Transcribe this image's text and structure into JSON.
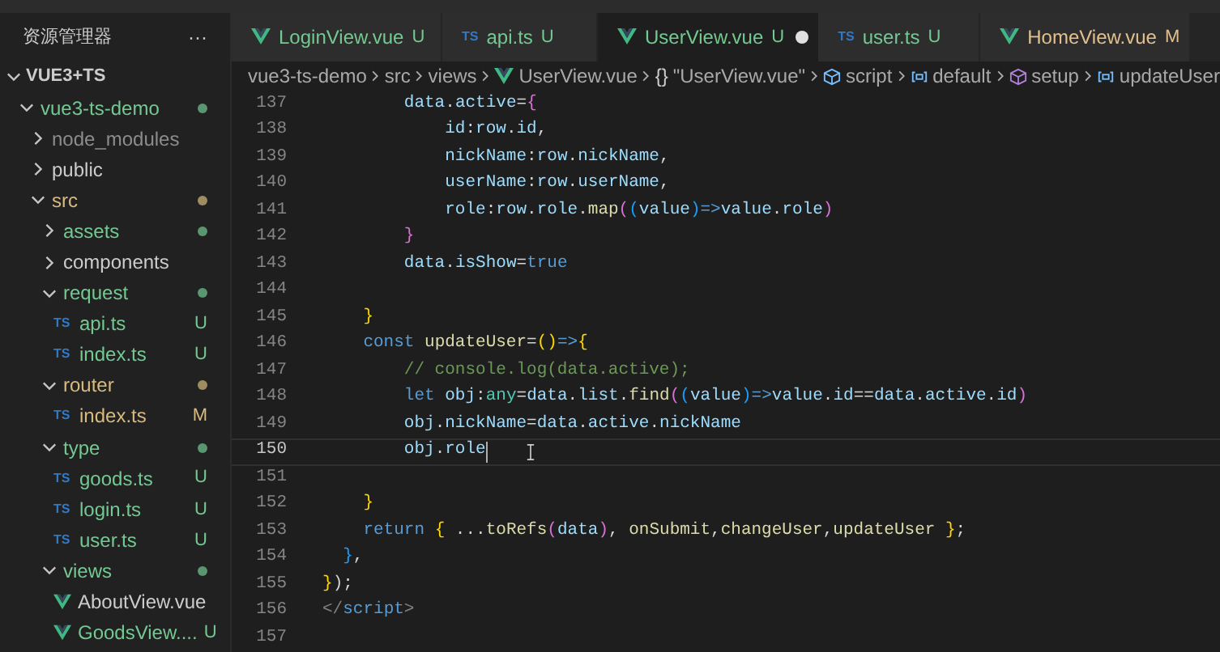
{
  "sidebar": {
    "title": "资源管理器",
    "more": "···",
    "section": {
      "label": "VUE3+TS",
      "expanded": true
    },
    "tree": [
      {
        "name": "vue3-ts-demo",
        "kind": "folder",
        "expanded": true,
        "color": "#73c991",
        "dot": true,
        "children": [
          {
            "name": "node_modules",
            "kind": "folder",
            "expanded": false,
            "color": "#8c8c8c",
            "dot": false
          },
          {
            "name": "public",
            "kind": "folder",
            "expanded": false,
            "color": "#cccccc",
            "dot": false
          },
          {
            "name": "src",
            "kind": "folder",
            "expanded": true,
            "color": "#d7ba7d",
            "dot": true,
            "children": [
              {
                "name": "assets",
                "kind": "folder",
                "expanded": false,
                "color": "#73c991",
                "dot": true
              },
              {
                "name": "components",
                "kind": "folder",
                "expanded": false,
                "color": "#cccccc",
                "dot": false
              },
              {
                "name": "request",
                "kind": "folder",
                "expanded": true,
                "color": "#73c991",
                "dot": true,
                "children": [
                  {
                    "name": "api.ts",
                    "kind": "ts",
                    "icon_text": "TS",
                    "color": "#73c991",
                    "badge": "U"
                  },
                  {
                    "name": "index.ts",
                    "kind": "ts",
                    "icon_text": "TS",
                    "color": "#73c991",
                    "badge": "U"
                  }
                ]
              },
              {
                "name": "router",
                "kind": "folder",
                "expanded": true,
                "color": "#d7ba7d",
                "dot": true,
                "children": [
                  {
                    "name": "index.ts",
                    "kind": "ts",
                    "icon_text": "TS",
                    "color": "#d7ba7d",
                    "badge": "M"
                  }
                ]
              },
              {
                "name": "type",
                "kind": "folder",
                "expanded": true,
                "color": "#73c991",
                "dot": true,
                "children": [
                  {
                    "name": "goods.ts",
                    "kind": "ts",
                    "icon_text": "TS",
                    "color": "#73c991",
                    "badge": "U"
                  },
                  {
                    "name": "login.ts",
                    "kind": "ts",
                    "icon_text": "TS",
                    "color": "#73c991",
                    "badge": "U"
                  },
                  {
                    "name": "user.ts",
                    "kind": "ts",
                    "icon_text": "TS",
                    "color": "#73c991",
                    "badge": "U"
                  }
                ]
              },
              {
                "name": "views",
                "kind": "folder",
                "expanded": true,
                "color": "#73c991",
                "dot": true,
                "children": [
                  {
                    "name": "AboutView.vue",
                    "kind": "vue",
                    "color": "#cccccc"
                  },
                  {
                    "name": "GoodsView....",
                    "kind": "vue",
                    "color": "#73c991",
                    "badge": "U"
                  }
                ]
              }
            ]
          }
        ]
      }
    ]
  },
  "tabs": [
    {
      "label": "LoginView.vue",
      "kind": "vue",
      "badge": "U",
      "color": "#73c991",
      "selected": false
    },
    {
      "label": "api.ts",
      "kind": "ts",
      "icon_text": "TS",
      "badge": "U",
      "color": "#73c991",
      "selected": false
    },
    {
      "label": "UserView.vue",
      "kind": "vue",
      "badge": "U",
      "color": "#73c991",
      "selected": true,
      "dirty": true
    },
    {
      "label": "user.ts",
      "kind": "ts",
      "icon_text": "TS",
      "badge": "U",
      "color": "#73c991",
      "selected": false
    },
    {
      "label": "HomeView.vue",
      "kind": "vue",
      "badge": "M",
      "color": "#e2c08d",
      "selected": false
    }
  ],
  "breadcrumb": [
    {
      "label": "vue3-ts-demo",
      "kind": "text"
    },
    {
      "label": "src",
      "kind": "text"
    },
    {
      "label": "views",
      "kind": "text"
    },
    {
      "label": "UserView.vue",
      "kind": "vue"
    },
    {
      "label": "\"UserView.vue\"",
      "kind": "braces",
      "icon_text": "{}"
    },
    {
      "label": "script",
      "kind": "cube"
    },
    {
      "label": "default",
      "kind": "variable"
    },
    {
      "label": "setup",
      "kind": "method"
    },
    {
      "label": "updateUser",
      "kind": "variable"
    }
  ],
  "editor": {
    "lines": [
      {
        "number": "137",
        "current": false,
        "tokens": [
          {
            "kind": "var",
            "text": "        data"
          },
          {
            "kind": "plain",
            "text": "."
          },
          {
            "kind": "var",
            "text": "active"
          },
          {
            "kind": "plain",
            "text": "="
          },
          {
            "kind": "b2",
            "text": "{"
          }
        ]
      },
      {
        "number": "138",
        "current": false,
        "tokens": [
          {
            "kind": "var",
            "text": "            id"
          },
          {
            "kind": "plain",
            "text": ":"
          },
          {
            "kind": "var",
            "text": "row"
          },
          {
            "kind": "plain",
            "text": "."
          },
          {
            "kind": "var",
            "text": "id"
          },
          {
            "kind": "plain",
            "text": ","
          }
        ]
      },
      {
        "number": "139",
        "current": false,
        "tokens": [
          {
            "kind": "var",
            "text": "            nickName"
          },
          {
            "kind": "plain",
            "text": ":"
          },
          {
            "kind": "var",
            "text": "row"
          },
          {
            "kind": "plain",
            "text": "."
          },
          {
            "kind": "var",
            "text": "nickName"
          },
          {
            "kind": "plain",
            "text": ","
          }
        ]
      },
      {
        "number": "140",
        "current": false,
        "tokens": [
          {
            "kind": "var",
            "text": "            userName"
          },
          {
            "kind": "plain",
            "text": ":"
          },
          {
            "kind": "var",
            "text": "row"
          },
          {
            "kind": "plain",
            "text": "."
          },
          {
            "kind": "var",
            "text": "userName"
          },
          {
            "kind": "plain",
            "text": ","
          }
        ]
      },
      {
        "number": "141",
        "current": false,
        "tokens": [
          {
            "kind": "var",
            "text": "            role"
          },
          {
            "kind": "plain",
            "text": ":"
          },
          {
            "kind": "var",
            "text": "row"
          },
          {
            "kind": "plain",
            "text": "."
          },
          {
            "kind": "var",
            "text": "role"
          },
          {
            "kind": "plain",
            "text": "."
          },
          {
            "kind": "fn",
            "text": "map"
          },
          {
            "kind": "b2",
            "text": "("
          },
          {
            "kind": "b3",
            "text": "("
          },
          {
            "kind": "var",
            "text": "value"
          },
          {
            "kind": "b3",
            "text": ")"
          },
          {
            "kind": "kw",
            "text": "=>"
          },
          {
            "kind": "var",
            "text": "value"
          },
          {
            "kind": "plain",
            "text": "."
          },
          {
            "kind": "var",
            "text": "role"
          },
          {
            "kind": "b2",
            "text": ")"
          }
        ]
      },
      {
        "number": "142",
        "current": false,
        "tokens": [
          {
            "kind": "b2",
            "text": "        }"
          }
        ]
      },
      {
        "number": "143",
        "current": false,
        "tokens": [
          {
            "kind": "var",
            "text": "        data"
          },
          {
            "kind": "plain",
            "text": "."
          },
          {
            "kind": "var",
            "text": "isShow"
          },
          {
            "kind": "plain",
            "text": "="
          },
          {
            "kind": "kw",
            "text": "true"
          }
        ]
      },
      {
        "number": "144",
        "current": false
      },
      {
        "number": "145",
        "current": false,
        "tokens": [
          {
            "kind": "b1",
            "text": "    }"
          }
        ]
      },
      {
        "number": "146",
        "current": false,
        "tokens": [
          {
            "kind": "kw",
            "text": "    const "
          },
          {
            "kind": "fn",
            "text": "updateUser"
          },
          {
            "kind": "plain",
            "text": "="
          },
          {
            "kind": "b1",
            "text": "()"
          },
          {
            "kind": "kw",
            "text": "=>"
          },
          {
            "kind": "b1",
            "text": "{"
          }
        ]
      },
      {
        "number": "147",
        "current": false,
        "tokens": [
          {
            "kind": "comment",
            "text": "        // console.log(data.active);"
          }
        ]
      },
      {
        "number": "148",
        "current": false,
        "tokens": [
          {
            "kind": "kw",
            "text": "        let "
          },
          {
            "kind": "var",
            "text": "obj"
          },
          {
            "kind": "plain",
            "text": ":"
          },
          {
            "kind": "type",
            "text": "any"
          },
          {
            "kind": "plain",
            "text": "="
          },
          {
            "kind": "var",
            "text": "data"
          },
          {
            "kind": "plain",
            "text": "."
          },
          {
            "kind": "var",
            "text": "list"
          },
          {
            "kind": "plain",
            "text": "."
          },
          {
            "kind": "fn",
            "text": "find"
          },
          {
            "kind": "b2",
            "text": "("
          },
          {
            "kind": "b3",
            "text": "("
          },
          {
            "kind": "var",
            "text": "value"
          },
          {
            "kind": "b3",
            "text": ")"
          },
          {
            "kind": "kw",
            "text": "=>"
          },
          {
            "kind": "var",
            "text": "value"
          },
          {
            "kind": "plain",
            "text": "."
          },
          {
            "kind": "var",
            "text": "id"
          },
          {
            "kind": "plain",
            "text": "=="
          },
          {
            "kind": "var",
            "text": "data"
          },
          {
            "kind": "plain",
            "text": "."
          },
          {
            "kind": "var",
            "text": "active"
          },
          {
            "kind": "plain",
            "text": "."
          },
          {
            "kind": "var",
            "text": "id"
          },
          {
            "kind": "b2",
            "text": ")"
          }
        ]
      },
      {
        "number": "149",
        "current": false,
        "tokens": [
          {
            "kind": "var",
            "text": "        obj"
          },
          {
            "kind": "plain",
            "text": "."
          },
          {
            "kind": "var",
            "text": "nickName"
          },
          {
            "kind": "plain",
            "text": "="
          },
          {
            "kind": "var",
            "text": "data"
          },
          {
            "kind": "plain",
            "text": "."
          },
          {
            "kind": "var",
            "text": "active"
          },
          {
            "kind": "plain",
            "text": "."
          },
          {
            "kind": "var",
            "text": "nickName"
          }
        ]
      },
      {
        "number": "150",
        "current": true,
        "tokens": [
          {
            "kind": "var",
            "text": "        obj"
          },
          {
            "kind": "plain",
            "text": "."
          },
          {
            "kind": "var",
            "text": "role"
          }
        ]
      },
      {
        "number": "151",
        "current": false
      },
      {
        "number": "152",
        "current": false,
        "tokens": [
          {
            "kind": "b1",
            "text": "    }"
          }
        ]
      },
      {
        "number": "153",
        "current": false,
        "tokens": [
          {
            "kind": "kw",
            "text": "    return "
          },
          {
            "kind": "b1",
            "text": "{"
          },
          {
            "kind": "plain",
            "text": " ..."
          },
          {
            "kind": "fn",
            "text": "toRefs"
          },
          {
            "kind": "b2",
            "text": "("
          },
          {
            "kind": "var",
            "text": "data"
          },
          {
            "kind": "b2",
            "text": ")"
          },
          {
            "kind": "plain",
            "text": ", "
          },
          {
            "kind": "fn",
            "text": "onSubmit"
          },
          {
            "kind": "plain",
            "text": ","
          },
          {
            "kind": "fn",
            "text": "changeUser"
          },
          {
            "kind": "plain",
            "text": ","
          },
          {
            "kind": "fn",
            "text": "updateUser "
          },
          {
            "kind": "b1",
            "text": "}"
          },
          {
            "kind": "plain",
            "text": ";"
          }
        ]
      },
      {
        "number": "154",
        "current": false,
        "tokens": [
          {
            "kind": "b3",
            "text": "  }"
          },
          {
            "kind": "plain",
            "text": ","
          }
        ]
      },
      {
        "number": "155",
        "current": false,
        "tokens": [
          {
            "kind": "b1",
            "text": "}"
          },
          {
            "kind": "plain",
            "text": ");"
          }
        ]
      },
      {
        "number": "156",
        "current": false,
        "tokens": [
          {
            "kind": "punct",
            "text": "</"
          },
          {
            "kind": "tag",
            "text": "script"
          },
          {
            "kind": "punct",
            "text": ">"
          }
        ]
      },
      {
        "number": "157",
        "current": false
      }
    ]
  }
}
